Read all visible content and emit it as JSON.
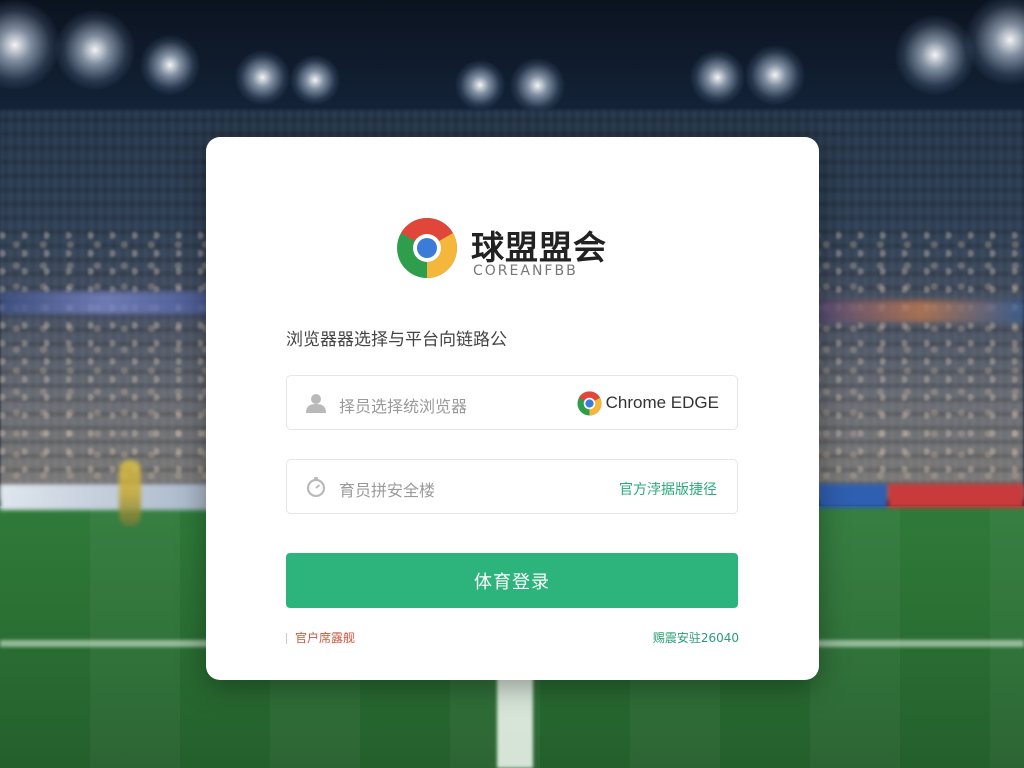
{
  "brand": {
    "name": "球盟盟会",
    "subtitle": "COREANFBB"
  },
  "login": {
    "section_title": "浏览器器选择与平台向链路公",
    "browser_field": {
      "placeholder": "择员选择统浏览器",
      "badge_label": "Chrome EDGE"
    },
    "code_field": {
      "placeholder": "育员拼安全楼",
      "link_label": "官方浡据版捷径"
    },
    "submit_label": "体育登录",
    "footer": {
      "left_text": "官户席露舰",
      "right_text": "赐震安驻26040"
    }
  },
  "colors": {
    "accent": "#2db47c",
    "link": "#2bab7a",
    "warning_text": "#d0553c"
  },
  "icons": {
    "logo": "chrome-logo-icon",
    "browser_field": "user-icon",
    "browser_badge": "chrome-icon",
    "code_field": "clock-icon"
  }
}
